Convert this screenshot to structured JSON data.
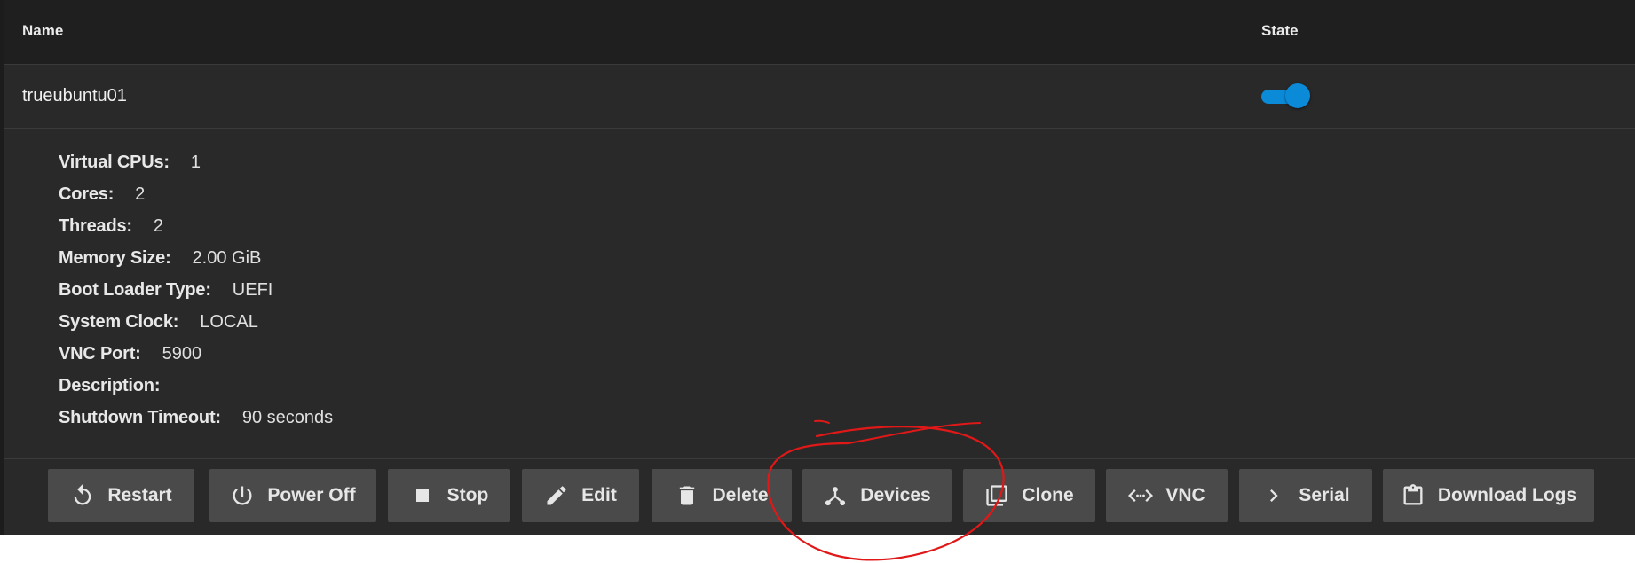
{
  "table": {
    "columns": {
      "name": "Name",
      "state": "State"
    },
    "vm": {
      "name": "trueubuntu01",
      "state_on": true
    }
  },
  "details": [
    {
      "label": "Virtual CPUs:",
      "value": "1"
    },
    {
      "label": "Cores:",
      "value": "2"
    },
    {
      "label": "Threads:",
      "value": "2"
    },
    {
      "label": "Memory Size:",
      "value": "2.00 GiB"
    },
    {
      "label": "Boot Loader Type:",
      "value": "UEFI"
    },
    {
      "label": "System Clock:",
      "value": "LOCAL"
    },
    {
      "label": "VNC Port:",
      "value": "5900"
    },
    {
      "label": "Description:",
      "value": ""
    },
    {
      "label": "Shutdown Timeout:",
      "value": "90 seconds"
    }
  ],
  "actions": [
    {
      "label": "Restart",
      "icon": "restart-icon"
    },
    {
      "label": "Power Off",
      "icon": "power-icon"
    },
    {
      "label": "Stop",
      "icon": "stop-icon"
    },
    {
      "label": "Edit",
      "icon": "pencil-icon"
    },
    {
      "label": "Delete",
      "icon": "trash-icon"
    },
    {
      "label": "Devices",
      "icon": "devices-icon"
    },
    {
      "label": "Clone",
      "icon": "clone-icon"
    },
    {
      "label": "VNC",
      "icon": "code-arrows-icon"
    },
    {
      "label": "Serial",
      "icon": "chevron-right-icon"
    },
    {
      "label": "Download Logs",
      "icon": "clipboard-icon"
    }
  ],
  "colors": {
    "panel_bg": "#292929",
    "header_bg": "#1f1f1f",
    "button_bg": "#4a4a4a",
    "toggle_on": "#0b8ad8",
    "annotation_stroke": "#e01818"
  }
}
